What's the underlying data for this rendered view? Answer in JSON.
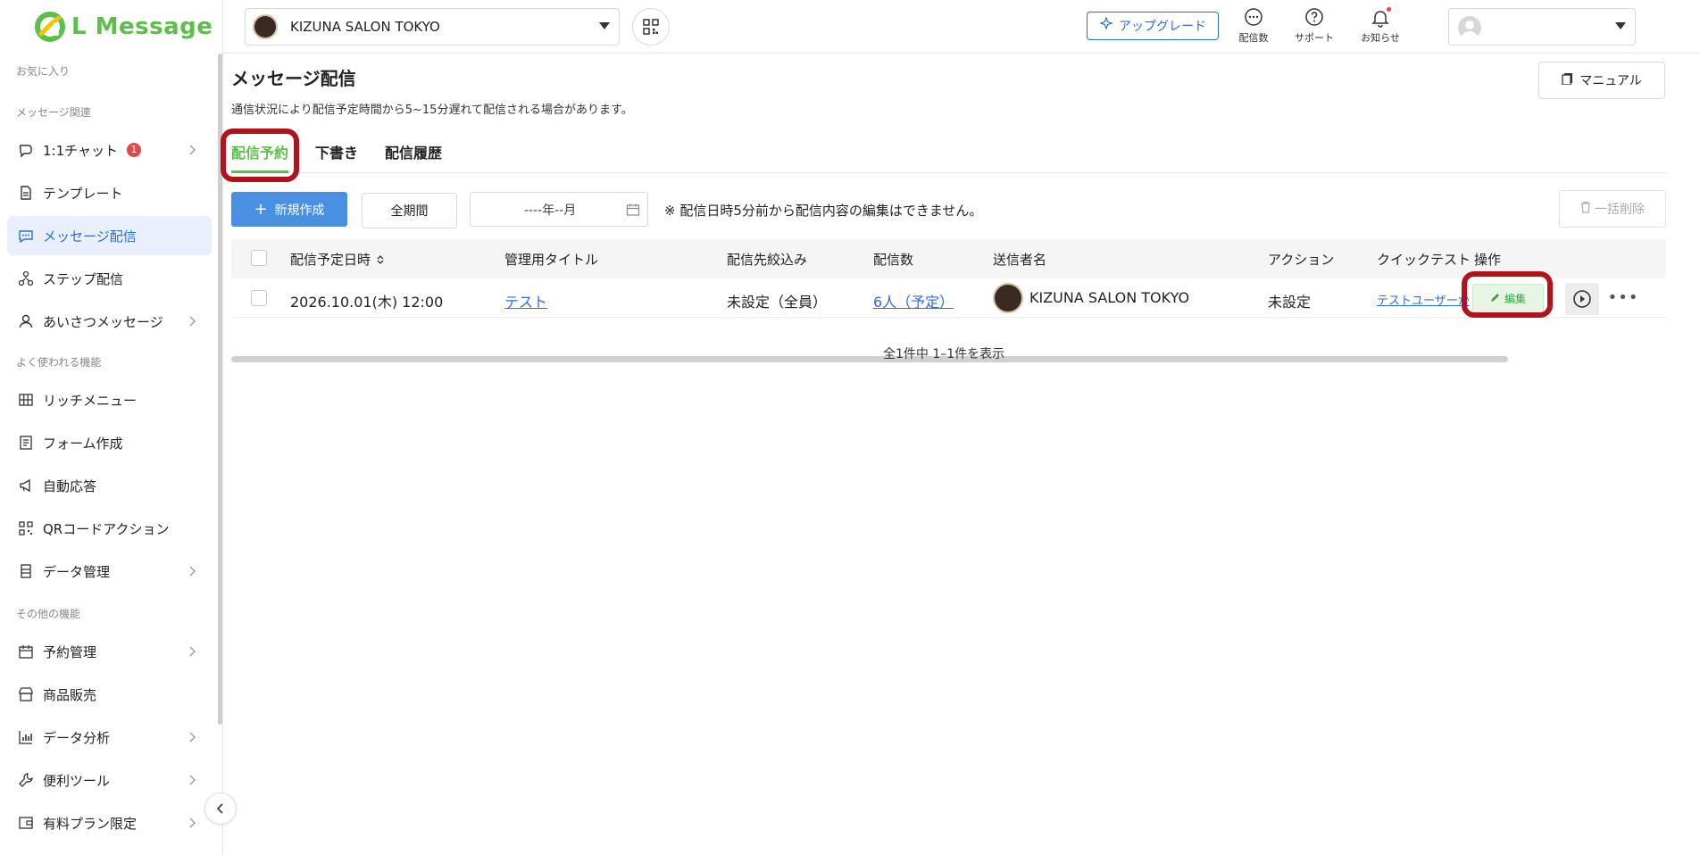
{
  "brand": {
    "name": "L Message",
    "color": "#5cbf4a"
  },
  "sidebar": {
    "sections": {
      "favorites": "お気に入り",
      "message": "メッセージ関連",
      "popular": "よく使われる機能",
      "other": "その他の機能"
    },
    "items": [
      {
        "label": "1:1チャット",
        "icon": "chat-icon",
        "badge": "1",
        "chevron": true
      },
      {
        "label": "テンプレート",
        "icon": "document-icon",
        "chevron": false
      },
      {
        "label": "メッセージ配信",
        "icon": "message-icon",
        "chevron": false,
        "active": true
      },
      {
        "label": "ステップ配信",
        "icon": "step-icon",
        "chevron": false
      },
      {
        "label": "あいさつメッセージ",
        "icon": "user-icon",
        "chevron": true
      },
      {
        "label": "リッチメニュー",
        "icon": "grid-icon",
        "chevron": false
      },
      {
        "label": "フォーム作成",
        "icon": "form-icon",
        "chevron": false
      },
      {
        "label": "自動応答",
        "icon": "megaphone-icon",
        "chevron": false
      },
      {
        "label": "QRコードアクション",
        "icon": "qr-icon",
        "chevron": false
      },
      {
        "label": "データ管理",
        "icon": "database-icon",
        "chevron": true
      },
      {
        "label": "予約管理",
        "icon": "calendar-icon",
        "chevron": true
      },
      {
        "label": "商品販売",
        "icon": "store-icon",
        "chevron": false
      },
      {
        "label": "データ分析",
        "icon": "bar-chart-icon",
        "chevron": true
      },
      {
        "label": "便利ツール",
        "icon": "wrench-icon",
        "chevron": true
      },
      {
        "label": "有料プラン限定",
        "icon": "wallet-icon",
        "chevron": true
      }
    ]
  },
  "header": {
    "account_name": "KIZUNA SALON TOKYO",
    "upgrade_label": "アップグレード",
    "icons": [
      {
        "label": "配信数",
        "icon": "chat-bubble-icon"
      },
      {
        "label": "サポート",
        "icon": "help-icon"
      },
      {
        "label": "お知らせ",
        "icon": "bell-icon"
      }
    ]
  },
  "page": {
    "title": "メッセージ配信",
    "note": "通信状況により配信予定時間から5~15分遅れて配信される場合があります。",
    "manual_label": "マニュアル",
    "tabs": [
      "配信予約",
      "下書き",
      "配信履歴"
    ],
    "active_tab": "配信予約",
    "toolbar": {
      "new_label": "新規作成",
      "period_label": "全期間",
      "month_placeholder": "----年--月",
      "note": "※ 配信日時5分前から配信内容の編集はできません。",
      "bulk_delete_label": "一括削除"
    },
    "table": {
      "headers": [
        "配信予定日時",
        "管理用タイトル",
        "配信先絞込み",
        "配信数",
        "送信者名",
        "アクション",
        "クイックテスト",
        "操作"
      ],
      "rows": [
        {
          "datetime": "2026.10.01(木) 12:00",
          "title": "テスト",
          "filter": "未設定（全員）",
          "count": "6人（予定）",
          "sender": "KIZUNA SALON TOKYO",
          "action": "未設定",
          "quick_test": "テストユーザーか",
          "edit_label": "編集"
        }
      ]
    },
    "pagination": "全1件中 1–1件を表示"
  },
  "colors": {
    "accent": "#5cbf4a",
    "primary": "#4a90e2",
    "link": "#2f6fd1",
    "highlight": "#b3121c"
  }
}
